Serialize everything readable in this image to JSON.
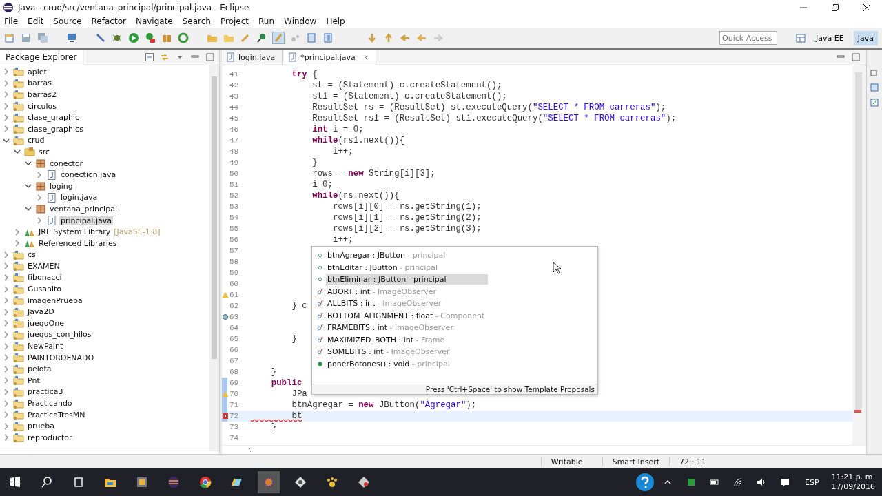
{
  "window": {
    "title": "Java - crud/src/ventana_principal/principal.java - Eclipse"
  },
  "menu": [
    "File",
    "Edit",
    "Source",
    "Refactor",
    "Navigate",
    "Search",
    "Project",
    "Run",
    "Window",
    "Help"
  ],
  "quick_access": {
    "placeholder": "Quick Access"
  },
  "perspectives": [
    {
      "label": "Java EE",
      "selected": false
    },
    {
      "label": "Java",
      "selected": true
    }
  ],
  "explorer": {
    "title": "Package Explorer",
    "items": [
      {
        "label": "aplet",
        "kind": "project",
        "expanded": false,
        "selected": false
      },
      {
        "label": "barras",
        "kind": "project",
        "expanded": false,
        "selected": false
      },
      {
        "label": "barras2",
        "kind": "project",
        "expanded": false,
        "selected": false
      },
      {
        "label": "circulos",
        "kind": "project",
        "expanded": false,
        "selected": false
      },
      {
        "label": "clase_graphic",
        "kind": "project",
        "expanded": false,
        "selected": false
      },
      {
        "label": "clase_graphics",
        "kind": "project",
        "expanded": false,
        "selected": false
      },
      {
        "label": "crud",
        "kind": "project",
        "expanded": true,
        "selected": false,
        "children": [
          {
            "label": "src",
            "kind": "folder",
            "expanded": true,
            "selected": false,
            "children": [
              {
                "label": "conector",
                "kind": "package",
                "expanded": true,
                "selected": false,
                "children": [
                  {
                    "label": "conection.java",
                    "kind": "file",
                    "expanded": false,
                    "selected": false
                  }
                ]
              },
              {
                "label": "loging",
                "kind": "package",
                "expanded": true,
                "selected": false,
                "children": [
                  {
                    "label": "login.java",
                    "kind": "file",
                    "expanded": false,
                    "selected": false
                  }
                ]
              },
              {
                "label": "ventana_principal",
                "kind": "package",
                "expanded": true,
                "selected": false,
                "children": [
                  {
                    "label": "principal.java",
                    "kind": "file",
                    "expanded": false,
                    "selected": true
                  }
                ]
              }
            ]
          },
          {
            "label": "JRE System Library",
            "suffix": "[JavaSE-1.8]",
            "kind": "library",
            "expanded": false,
            "selected": false
          },
          {
            "label": "Referenced Libraries",
            "kind": "library",
            "expanded": false,
            "selected": false
          }
        ]
      },
      {
        "label": "cs",
        "kind": "project",
        "expanded": false,
        "selected": false
      },
      {
        "label": "EXAMEN",
        "kind": "project",
        "expanded": false,
        "selected": false
      },
      {
        "label": "fibonacci",
        "kind": "project",
        "expanded": false,
        "selected": false
      },
      {
        "label": "Gusanito",
        "kind": "project",
        "expanded": false,
        "selected": false
      },
      {
        "label": "imagenPrueba",
        "kind": "project",
        "expanded": false,
        "selected": false
      },
      {
        "label": "Java2D",
        "kind": "project",
        "expanded": false,
        "selected": false
      },
      {
        "label": "juegoOne",
        "kind": "project",
        "expanded": false,
        "selected": false
      },
      {
        "label": "juegos_con_hilos",
        "kind": "project",
        "expanded": false,
        "selected": false
      },
      {
        "label": "NewPaint",
        "kind": "project",
        "expanded": false,
        "selected": false
      },
      {
        "label": "PAINTORDENADO",
        "kind": "project",
        "expanded": false,
        "selected": false
      },
      {
        "label": "pelota",
        "kind": "project",
        "expanded": false,
        "selected": false
      },
      {
        "label": "Pnt",
        "kind": "project",
        "expanded": false,
        "selected": false
      },
      {
        "label": "practica3",
        "kind": "project",
        "expanded": false,
        "selected": false
      },
      {
        "label": "Practicando",
        "kind": "project",
        "expanded": false,
        "selected": false
      },
      {
        "label": "PracticaTresMN",
        "kind": "project",
        "expanded": false,
        "selected": false
      },
      {
        "label": "prueba",
        "kind": "project",
        "expanded": false,
        "selected": false
      },
      {
        "label": "reproductor",
        "kind": "project",
        "expanded": false,
        "selected": false
      }
    ]
  },
  "editor_tabs": [
    {
      "label": "login.java",
      "selected": false
    },
    {
      "label": "*principal.java",
      "selected": true
    }
  ],
  "code_lines": [
    {
      "n": "41",
      "parts": [
        {
          "t": "        try",
          "kind": "keyword"
        },
        {
          "t": " {",
          "kind": "plain"
        }
      ]
    },
    {
      "n": "42",
      "parts": [
        {
          "t": "            st = (Statement) c.createStatement();",
          "kind": "plain"
        }
      ]
    },
    {
      "n": "43",
      "parts": [
        {
          "t": "            st1 = (Statement) c.createStatement();",
          "kind": "plain"
        }
      ]
    },
    {
      "n": "44",
      "parts": [
        {
          "t": "            ResultSet rs = (ResultSet) st.executeQuery(",
          "kind": "plain"
        },
        {
          "t": "\"SELECT * FROM carreras\"",
          "kind": "string"
        },
        {
          "t": ");",
          "kind": "plain"
        }
      ]
    },
    {
      "n": "45",
      "parts": [
        {
          "t": "            ResultSet rs1 = (ResultSet) st1.executeQuery(",
          "kind": "plain"
        },
        {
          "t": "\"SELECT * FROM carreras\"",
          "kind": "string"
        },
        {
          "t": ");",
          "kind": "plain"
        }
      ]
    },
    {
      "n": "46",
      "parts": [
        {
          "t": "            int",
          "kind": "keyword"
        },
        {
          "t": " i = 0;",
          "kind": "plain"
        }
      ]
    },
    {
      "n": "47",
      "parts": [
        {
          "t": "            while",
          "kind": "keyword"
        },
        {
          "t": "(rs1.next()){",
          "kind": "plain"
        }
      ]
    },
    {
      "n": "48",
      "parts": [
        {
          "t": "                i++;",
          "kind": "plain"
        }
      ]
    },
    {
      "n": "49",
      "parts": [
        {
          "t": "            }",
          "kind": "plain"
        }
      ]
    },
    {
      "n": "50",
      "parts": [
        {
          "t": "            rows = ",
          "kind": "plain"
        },
        {
          "t": "new",
          "kind": "keyword"
        },
        {
          "t": " String[i][3];",
          "kind": "plain"
        }
      ]
    },
    {
      "n": "51",
      "parts": [
        {
          "t": "            i=0;",
          "kind": "plain"
        }
      ]
    },
    {
      "n": "52",
      "parts": [
        {
          "t": "            while",
          "kind": "keyword"
        },
        {
          "t": "(rs.next()){",
          "kind": "plain"
        }
      ]
    },
    {
      "n": "53",
      "parts": [
        {
          "t": "                rows[i][0] = rs.getString(1);",
          "kind": "plain"
        }
      ]
    },
    {
      "n": "54",
      "parts": [
        {
          "t": "                rows[i][1] = rs.getString(2);",
          "kind": "plain"
        }
      ]
    },
    {
      "n": "55",
      "parts": [
        {
          "t": "                rows[i][2] = rs.getString(3);",
          "kind": "plain"
        }
      ]
    },
    {
      "n": "56",
      "parts": [
        {
          "t": "                i++;",
          "kind": "plain"
        }
      ]
    },
    {
      "n": "57"
    },
    {
      "n": "58"
    },
    {
      "n": "59"
    },
    {
      "n": "60"
    },
    {
      "n": "61",
      "marker": {
        "kind": "warning"
      }
    },
    {
      "n": "62",
      "parts": [
        {
          "t": "        } c",
          "kind": "plain"
        }
      ]
    },
    {
      "n": "63",
      "marker": {
        "kind": "info"
      }
    },
    {
      "n": "64"
    },
    {
      "n": "65",
      "parts": [
        {
          "t": "        }",
          "kind": "plain"
        }
      ]
    },
    {
      "n": "66"
    },
    {
      "n": "67"
    },
    {
      "n": "68",
      "parts": [
        {
          "t": "    }",
          "kind": "plain"
        }
      ]
    },
    {
      "n": "69",
      "changed": true,
      "parts": [
        {
          "t": "    public",
          "kind": "keyword"
        }
      ]
    },
    {
      "n": "70",
      "changed": true,
      "marker": {
        "kind": "warning"
      },
      "parts": [
        {
          "t": "        JPa",
          "kind": "plain"
        }
      ]
    },
    {
      "n": "71",
      "changed": true,
      "parts": [
        {
          "t": "        btnAgregar = ",
          "kind": "plain"
        },
        {
          "t": "new",
          "kind": "keyword"
        },
        {
          "t": " JButton(",
          "kind": "plain"
        },
        {
          "t": "\"Agregar\"",
          "kind": "string"
        },
        {
          "t": ");",
          "kind": "plain"
        }
      ]
    },
    {
      "n": "72",
      "changed": true,
      "marker": {
        "kind": "error"
      },
      "current": true,
      "parts": [
        {
          "t": "        bt",
          "kind": "error"
        }
      ]
    },
    {
      "n": "73",
      "parts": [
        {
          "t": "    }",
          "kind": "plain"
        }
      ]
    },
    {
      "n": "74"
    }
  ],
  "completion": {
    "items": [
      {
        "kind": "field",
        "name": "btnAgregar : JButton",
        "owner": "- principal",
        "selected": false
      },
      {
        "kind": "field",
        "name": "btnEditar : JButton",
        "owner": "- principal",
        "selected": false
      },
      {
        "kind": "field",
        "name": "btnEliminar : JButton",
        "owner": "- principal",
        "selected": true
      },
      {
        "kind": "constant",
        "name": "ABORT : int",
        "owner": "- ImageObserver",
        "selected": false
      },
      {
        "kind": "constant",
        "name": "ALLBITS : int",
        "owner": "- ImageObserver",
        "selected": false
      },
      {
        "kind": "constant",
        "name": "BOTTOM_ALIGNMENT : float",
        "owner": "- Component",
        "selected": false
      },
      {
        "kind": "constant",
        "name": "FRAMEBITS : int",
        "owner": "- ImageObserver",
        "selected": false
      },
      {
        "kind": "constant",
        "name": "MAXIMIZED_BOTH : int",
        "owner": "- Frame",
        "selected": false
      },
      {
        "kind": "constant",
        "name": "SOMEBITS : int",
        "owner": "- ImageObserver",
        "selected": false
      },
      {
        "kind": "method",
        "name": "ponerBotones() : void",
        "owner": "- principal",
        "selected": false
      }
    ],
    "hint": "Press 'Ctrl+Space' to show Template Proposals"
  },
  "status_bar": [
    "Writable",
    "Smart Insert",
    "72 : 11"
  ],
  "taskbar": {
    "language": "ESP",
    "time": "11:21 p. m.",
    "date": "17/09/2016"
  }
}
